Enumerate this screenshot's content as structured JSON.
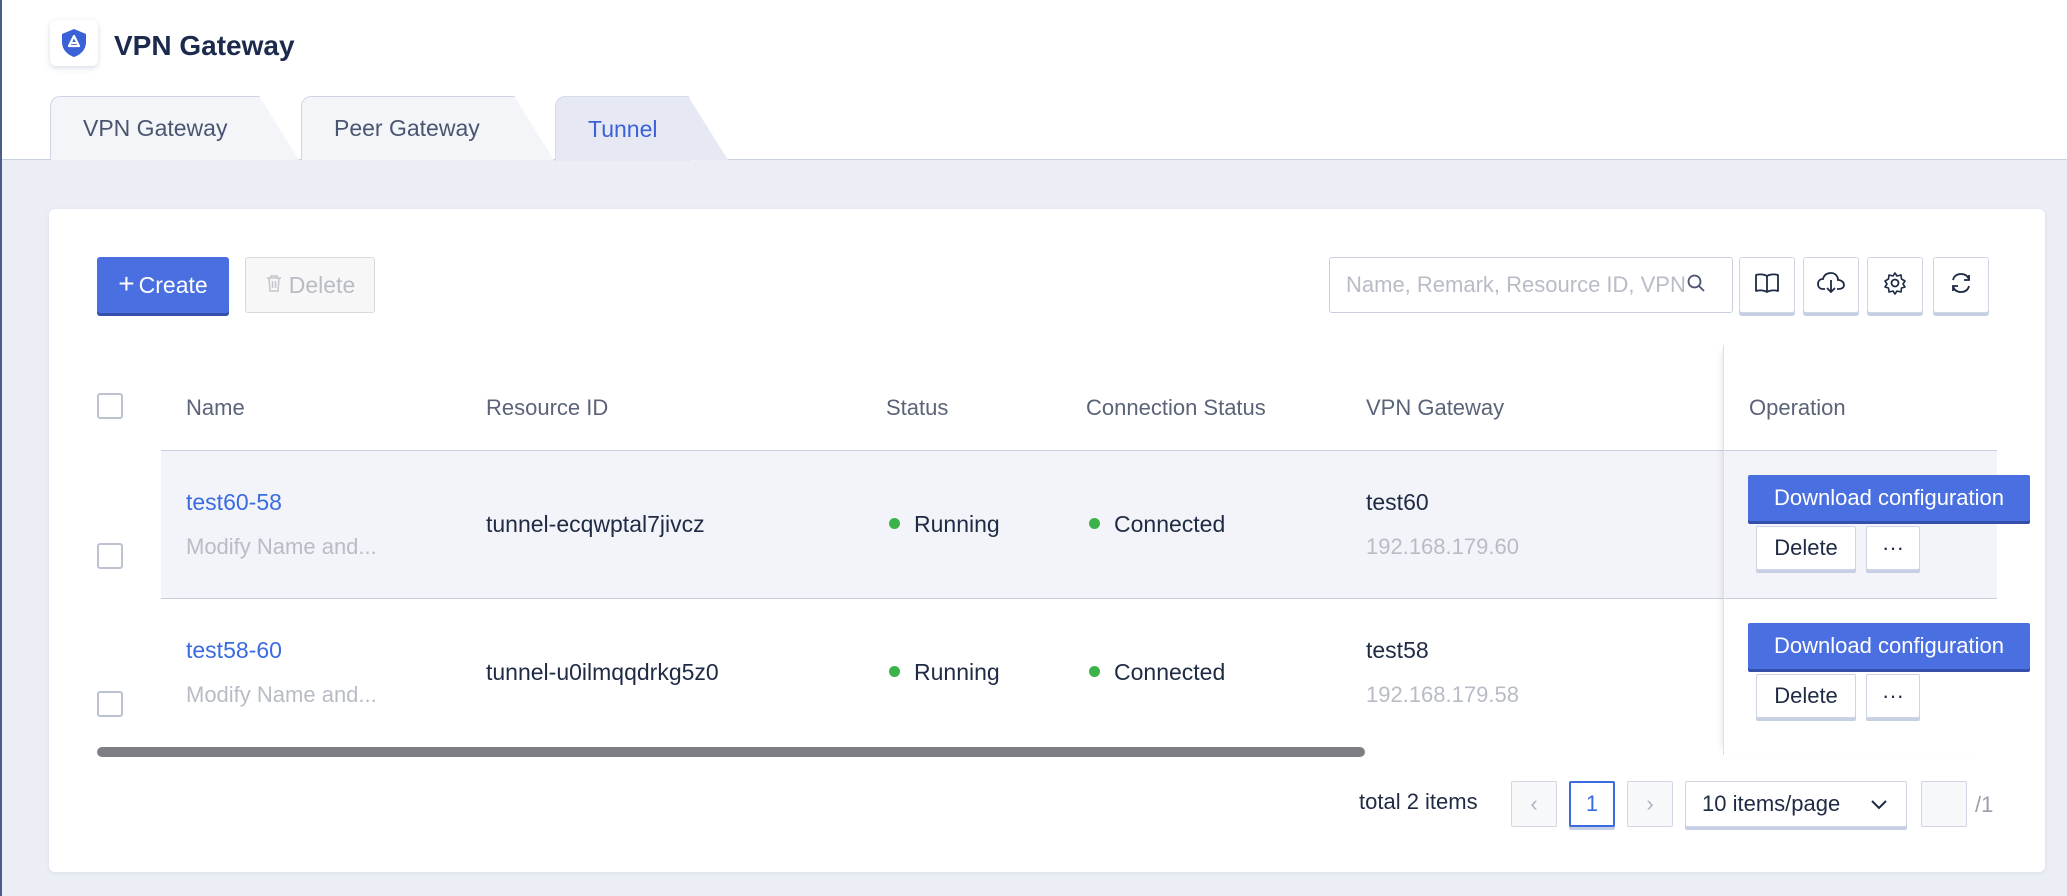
{
  "app": {
    "title": "VPN Gateway"
  },
  "tabs": [
    {
      "label": "VPN Gateway",
      "active": false
    },
    {
      "label": "Peer Gateway",
      "active": false
    },
    {
      "label": "Tunnel",
      "active": true
    }
  ],
  "toolbar": {
    "create_label": "Create",
    "delete_label": "Delete",
    "search_placeholder": "Name, Remark, Resource ID, VPN Gateway"
  },
  "table": {
    "columns": [
      "Name",
      "Resource ID",
      "Status",
      "Connection Status",
      "VPN Gateway",
      "Operation"
    ],
    "rows": [
      {
        "name": "test60-58",
        "remark": "Modify Name and...",
        "resource_id": "tunnel-ecqwptal7jivcz",
        "status": "Running",
        "connection_status": "Connected",
        "vpn_gateway": "test60",
        "vpn_gateway_ip": "192.168.179.60",
        "download_label": "Download configuration",
        "delete_label": "Delete",
        "more_label": "···"
      },
      {
        "name": "test58-60",
        "remark": "Modify Name and...",
        "resource_id": "tunnel-u0ilmqqdrkg5z0",
        "status": "Running",
        "connection_status": "Connected",
        "vpn_gateway": "test58",
        "vpn_gateway_ip": "192.168.179.58",
        "download_label": "Download configuration",
        "delete_label": "Delete",
        "more_label": "···"
      }
    ]
  },
  "pagination": {
    "total_text": "total 2 items",
    "prev": "‹",
    "current_page": "1",
    "next": "›",
    "page_size": "10 items/page",
    "total_pages": "/1"
  },
  "colors": {
    "accent": "#4a6fe0",
    "link": "#3a6be0",
    "status_ok": "#3bb24a"
  }
}
